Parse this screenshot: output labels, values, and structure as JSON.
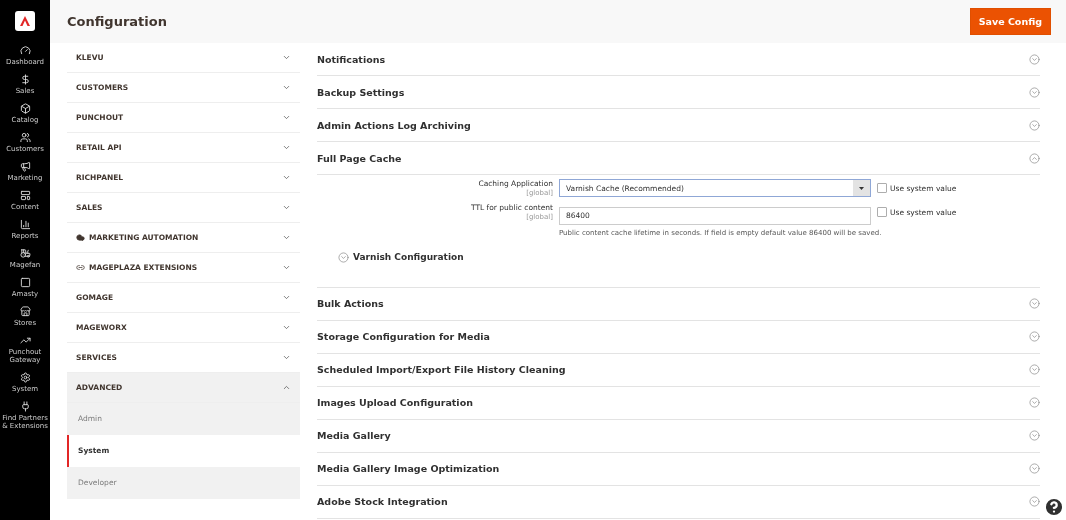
{
  "header": {
    "title": "Configuration",
    "save_button": "Save Config"
  },
  "nav": [
    {
      "label": "Dashboard",
      "kind": "dashboard"
    },
    {
      "label": "Sales",
      "kind": "sales"
    },
    {
      "label": "Catalog",
      "kind": "catalog"
    },
    {
      "label": "Customers",
      "kind": "customers"
    },
    {
      "label": "Marketing",
      "kind": "marketing"
    },
    {
      "label": "Content",
      "kind": "content"
    },
    {
      "label": "Reports",
      "kind": "reports"
    },
    {
      "label": "Magefan",
      "kind": "magefan"
    },
    {
      "label": "Amasty",
      "kind": "amasty"
    },
    {
      "label": "Stores",
      "kind": "stores"
    },
    {
      "label": "Punchout Gateway",
      "kind": "punchout"
    },
    {
      "label": "System",
      "kind": "system"
    },
    {
      "label": "Find Partners & Extensions",
      "kind": "partners"
    }
  ],
  "sections": [
    {
      "label": "KLEVU",
      "kind": "plain",
      "expanded": false
    },
    {
      "label": "CUSTOMERS",
      "kind": "plain",
      "expanded": false
    },
    {
      "label": "PUNCHOUT",
      "kind": "plain",
      "expanded": false
    },
    {
      "label": "RETAIL API",
      "kind": "plain",
      "expanded": false
    },
    {
      "label": "RICHPANEL",
      "kind": "plain",
      "expanded": false
    },
    {
      "label": "SALES",
      "kind": "plain",
      "expanded": false
    },
    {
      "label": "MARKETING AUTOMATION",
      "kind": "cloud",
      "expanded": false
    },
    {
      "label": "MAGEPLAZA EXTENSIONS",
      "kind": "plaza",
      "expanded": false
    },
    {
      "label": "GOMAGE",
      "kind": "plain",
      "expanded": false
    },
    {
      "label": "MAGEWORX",
      "kind": "plain",
      "expanded": false
    },
    {
      "label": "SERVICES",
      "kind": "plain",
      "expanded": false
    },
    {
      "label": "ADVANCED",
      "kind": "plain",
      "expanded": true,
      "children": [
        {
          "label": "Admin",
          "selected": false
        },
        {
          "label": "System",
          "selected": true
        },
        {
          "label": "Developer",
          "selected": false
        }
      ]
    }
  ],
  "groups": [
    {
      "title": "Notifications",
      "expanded": false
    },
    {
      "title": "Backup Settings",
      "expanded": false
    },
    {
      "title": "Admin Actions Log Archiving",
      "expanded": false
    },
    {
      "title": "Full Page Cache",
      "expanded": true,
      "fields": [
        {
          "kind": "select",
          "label": "Caching Application",
          "scope": "[global]",
          "value": "Varnish Cache (Recommended)",
          "use_system_value": false,
          "checkbox_label": "Use system value"
        },
        {
          "kind": "text",
          "label": "TTL for public content",
          "scope": "[global]",
          "value": "86400",
          "use_system_value": false,
          "checkbox_label": "Use system value",
          "note": "Public content cache lifetime in seconds. If field is empty default value 86400 will be saved."
        }
      ],
      "subgroup": {
        "title": "Varnish Configuration",
        "expanded": false
      }
    },
    {
      "title": "Bulk Actions",
      "expanded": false
    },
    {
      "title": "Storage Configuration for Media",
      "expanded": false
    },
    {
      "title": "Scheduled Import/Export File History Cleaning",
      "expanded": false
    },
    {
      "title": "Images Upload Configuration",
      "expanded": false
    },
    {
      "title": "Media Gallery",
      "expanded": false
    },
    {
      "title": "Media Gallery Image Optimization",
      "expanded": false
    },
    {
      "title": "Adobe Stock Integration",
      "expanded": false
    }
  ]
}
